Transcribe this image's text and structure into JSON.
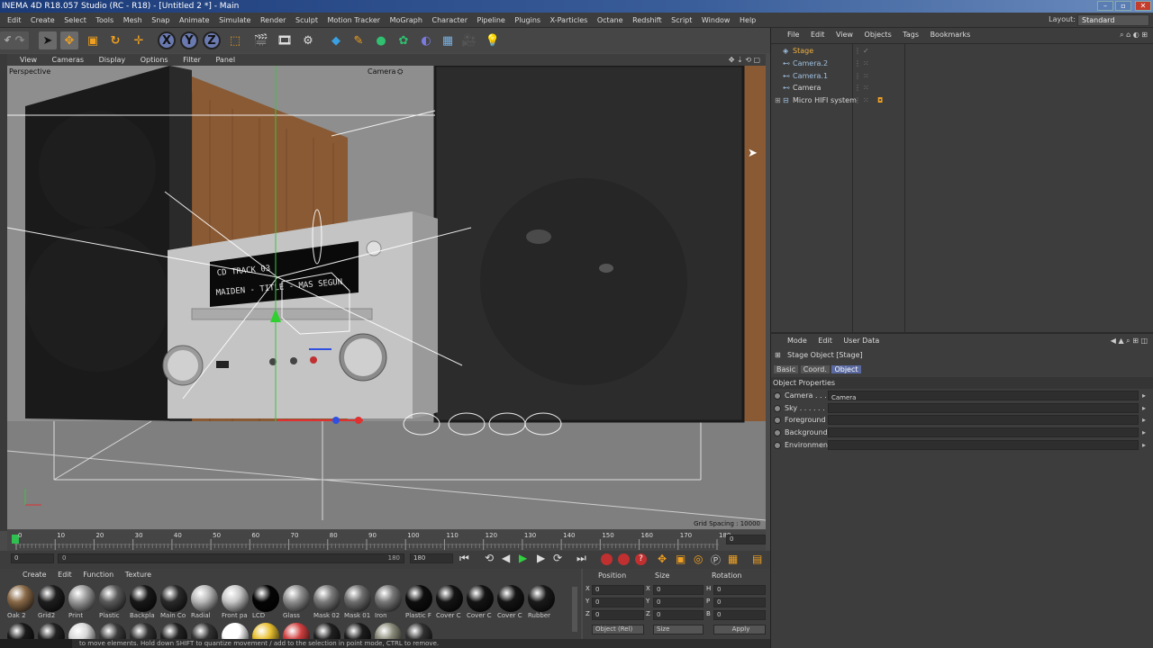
{
  "window": {
    "title": "INEMA 4D R18.057 Studio (RC - R18) - [Untitled 2 *] - Main"
  },
  "menubar": {
    "items": [
      "Edit",
      "Create",
      "Select",
      "Tools",
      "Mesh",
      "Snap",
      "Animate",
      "Simulate",
      "Render",
      "Sculpt",
      "Motion Tracker",
      "MoGraph",
      "Character",
      "Pipeline",
      "Plugins",
      "X-Particles",
      "Octane",
      "Redshift",
      "Script",
      "Window",
      "Help"
    ],
    "layout_label": "Layout:",
    "layout_value": "Standard"
  },
  "toolbar": {
    "icons": [
      "undo-icon",
      "redo-icon",
      "select-arrow-icon",
      "move-icon",
      "scale-icon",
      "rotate-icon",
      "live-select-icon",
      "x-axis-icon",
      "y-axis-icon",
      "z-axis-icon",
      "coord-system-icon",
      "render-view-icon",
      "render-picture-viewer-icon",
      "render-settings-icon",
      "cube-icon",
      "pen-icon",
      "subdivision-icon",
      "array-icon",
      "deformer-icon",
      "floor-icon",
      "camera-icon",
      "light-icon"
    ],
    "axis_x": "X",
    "axis_y": "Y",
    "axis_z": "Z"
  },
  "viewport": {
    "menu": [
      "View",
      "Cameras",
      "Display",
      "Options",
      "Filter",
      "Panel"
    ],
    "label": "Perspective",
    "camera_label": "Camera",
    "grid_spacing": "Grid Spacing : 10000",
    "display_line1": "CD TRACK 03",
    "display_line2": "MAIDEN - TITLE - MAS SEGUN"
  },
  "timeline": {
    "ticks": [
      "0",
      "10",
      "20",
      "30",
      "40",
      "50",
      "60",
      "70",
      "80",
      "90",
      "100",
      "110",
      "120",
      "130",
      "140",
      "150",
      "160",
      "170",
      "180"
    ],
    "current_frame": "0",
    "frame_field": "0"
  },
  "playbar": {
    "start": "0",
    "slider_start": "0",
    "slider_end": "180",
    "end": "180"
  },
  "materials": {
    "menu": [
      "Create",
      "Edit",
      "Function",
      "Texture"
    ],
    "items": [
      {
        "label": "Oak 2",
        "color": "#8a6a48"
      },
      {
        "label": "Grid2",
        "color": "#1e1e1e"
      },
      {
        "label": "Print",
        "color": "#9a9a9a"
      },
      {
        "label": "Plastic",
        "color": "#5a5a5a"
      },
      {
        "label": "Backpla",
        "color": "#181818"
      },
      {
        "label": "Main Co",
        "color": "#2a2a2a"
      },
      {
        "label": "Radial",
        "color": "#b8b8b8"
      },
      {
        "label": "Front pa",
        "color": "#c8c8c8"
      },
      {
        "label": "LCD",
        "color": "#050505"
      },
      {
        "label": "Glass",
        "color": "#8f8f8f"
      },
      {
        "label": "Mask 02",
        "color": "#7a7a7a"
      },
      {
        "label": "Mask 01",
        "color": "#6e6e6e"
      },
      {
        "label": "Iron",
        "color": "#777777"
      },
      {
        "label": "Plastic F",
        "color": "#0e0e0e"
      },
      {
        "label": "Cover C",
        "color": "#141414"
      },
      {
        "label": "Cover C",
        "color": "#141414"
      },
      {
        "label": "Cover C",
        "color": "#141414"
      },
      {
        "label": "Rubber",
        "color": "#1a1a1a"
      }
    ],
    "row2_colors": [
      "#1a1a1a",
      "#222222",
      "#d8d8d8",
      "#3a3a3a",
      "#303030",
      "#222222",
      "#333333",
      "#ffffff",
      "#e8c030",
      "#d04040",
      "#202020",
      "#1c1c1c",
      "#8a8a7a",
      "#303030"
    ]
  },
  "coordinates": {
    "headers": [
      "Position",
      "Size",
      "Rotation"
    ],
    "rows": [
      {
        "axis": "X",
        "pos": "0",
        "size": "0",
        "rot_axis": "H",
        "rot": "0"
      },
      {
        "axis": "Y",
        "pos": "0",
        "size": "0",
        "rot_axis": "P",
        "rot": "0"
      },
      {
        "axis": "Z",
        "pos": "0",
        "size": "0",
        "rot_axis": "B",
        "rot": "0"
      }
    ],
    "mode": "Object (Rel)",
    "size_mode": "Size",
    "apply": "Apply"
  },
  "status": {
    "text": "to move elements. Hold down SHIFT to quantize movement / add to the selection in point mode, CTRL to remove."
  },
  "object_manager": {
    "menu": [
      "File",
      "Edit",
      "View",
      "Objects",
      "Tags",
      "Bookmarks"
    ],
    "objects": [
      {
        "name": "Stage",
        "color": "#f0b040"
      },
      {
        "name": "Camera.2",
        "color": "#9fc0e0"
      },
      {
        "name": "Camera.1",
        "color": "#9fc0e0"
      },
      {
        "name": "Camera",
        "color": "#d8d8d8"
      },
      {
        "name": "Micro HIFI system",
        "color": "#d8d8d8"
      }
    ]
  },
  "attribute_manager": {
    "menu": [
      "Mode",
      "Edit",
      "User Data"
    ],
    "title": "Stage Object [Stage]",
    "tabs": [
      "Basic",
      "Coord.",
      "Object"
    ],
    "section": "Object Properties",
    "props": [
      {
        "label": "Camera . . .",
        "value": "Camera"
      },
      {
        "label": "Sky . . . . . . .",
        "value": ""
      },
      {
        "label": "Foreground",
        "value": ""
      },
      {
        "label": "Background",
        "value": ""
      },
      {
        "label": "Environment",
        "value": ""
      }
    ]
  }
}
